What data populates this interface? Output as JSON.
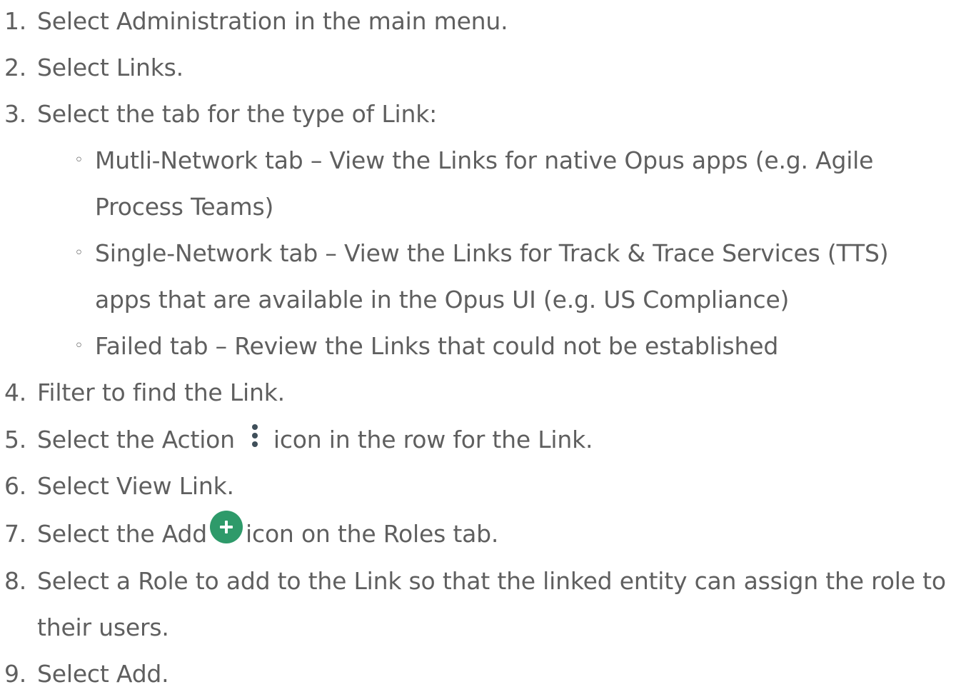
{
  "steps": [
    {
      "num": "1.",
      "text": "Select Administration in the main menu."
    },
    {
      "num": "2.",
      "text": "Select Links."
    },
    {
      "num": "3.",
      "text": "Select the tab for the type of Link:"
    },
    {
      "num": "4.",
      "text": "Filter to find the Link."
    },
    {
      "num": "5.",
      "text_before": "Select the Action",
      "text_after": "icon in the row for the Link.",
      "icon": "kebab-icon"
    },
    {
      "num": "6.",
      "text": "Select View Link."
    },
    {
      "num": "7.",
      "text_before": "Select the Add",
      "text_after": "icon on the Roles tab.",
      "icon": "add-icon"
    },
    {
      "num": "8.",
      "text": "Select a Role to add to the Link so that the linked entity can assign the role to",
      "text_cont": "their users."
    },
    {
      "num": "9.",
      "text": "Select Add."
    }
  ],
  "substeps": [
    {
      "bullet": "◦",
      "text": "Mutli-Network tab – View the Links for native Opus apps (e.g. Agile",
      "text_cont": "Process Teams)"
    },
    {
      "bullet": "◦",
      "text": "Single-Network tab – View the Links for Track & Trace Services (TTS)",
      "text_cont": "apps that are available in the Opus UI (e.g. US Compliance)"
    },
    {
      "bullet": "◦",
      "text": "Failed tab – Review the Links that could not be established"
    }
  ],
  "colors": {
    "text": "#5f5f5f",
    "add_icon": "#2e9a6a",
    "kebab_icon": "#3f4f5a"
  }
}
